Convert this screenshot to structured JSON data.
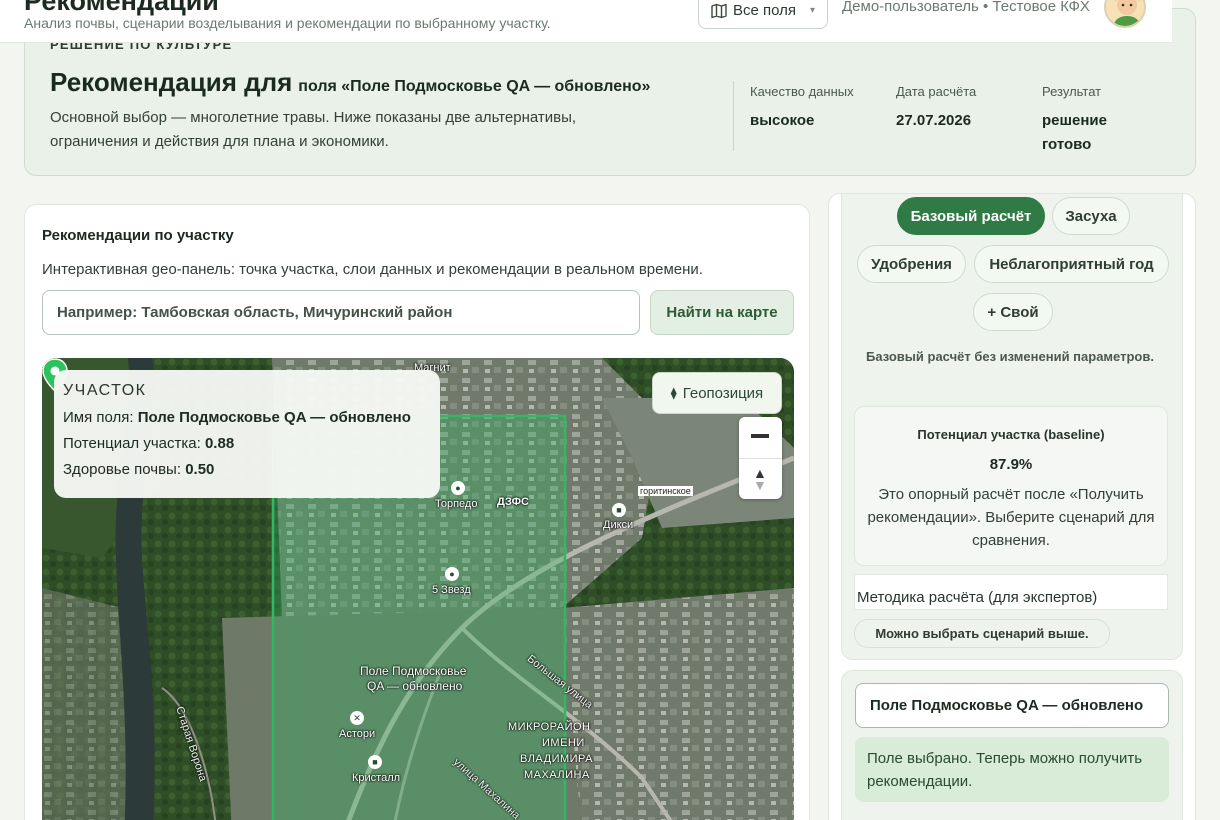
{
  "header": {
    "title": "Рекомендации",
    "subtitle": "Анализ почвы, сценарии возделывания и рекомендации по выбранному участку.",
    "fields_select": "Все поля",
    "user": "Демо-пользователь • Тестовое КФХ"
  },
  "decision": {
    "kicker": "РЕШЕНИЕ ПО КУЛЬТУРЕ",
    "title_main": "Рекомендация для",
    "title_field": "поля «Поле Подмосковье QA — обновлено»",
    "description": "Основной выбор — многолетние травы. Ниже показаны две альтернативы, ограничения и действия для плана и экономики.",
    "metrics": [
      {
        "label": "Качество данных",
        "value": "высокое"
      },
      {
        "label": "Дата расчёта",
        "value": "27.07.2026"
      },
      {
        "label": "Результат",
        "value": "решение готово"
      }
    ]
  },
  "left_panel": {
    "title": "Рекомендации по участку",
    "description": "Интерактивная geo-панель: точка участка, слои данных и рекомендации в реальном времени.",
    "search_placeholder": "Например: Тамбовская область, Мичуринский район",
    "find_button": "Найти на карте",
    "map": {
      "info": {
        "title": "УЧАСТОК",
        "field_name_label": "Имя поля:",
        "field_name_value": "Поле Подмосковье QA — обновлено",
        "potential_label": "Потенциал участка:",
        "potential_value": "0.88",
        "health_label": "Здоровье почвы:",
        "health_value": "0.50"
      },
      "geo_button": "Геопозиция",
      "labels": {
        "magnit": "Магнит",
        "torpedo": "Торпедо",
        "dzfs": "ДЗФС",
        "diksi": "Дикси",
        "zvezd": "5 Звезд",
        "field_pin_1": "Поле Подмосковье",
        "field_pin_2": "QA — обновлено",
        "bolshaya": "Большая улица",
        "mkr_1": "МИКРОРАЙОН",
        "mkr_2": "ИМЕНИ",
        "mkr_3": "ВЛАДИМИРА",
        "mkr_4": "МАХАЛИНА",
        "astori": "Астори",
        "kristall": "Кристалл",
        "mahalina": "улица Махалина",
        "staraya": "Старая Ворона",
        "road_sign": "горитинское"
      }
    }
  },
  "right_panel": {
    "scenarios": [
      "Базовый расчёт",
      "Засуха",
      "Удобрения",
      "Неблагоприятный год",
      "+ Свой"
    ],
    "scenario_description": "Базовый расчёт без изменений параметров.",
    "baseline": {
      "title": "Потенциал участка (baseline)",
      "value": "87.9%",
      "text": "Это опорный расчёт после «Получить рекомендации». Выберите сценарий для сравнения."
    },
    "method": "Методика расчёта (для экспертов)",
    "method_note": "Можно выбрать сценарий выше.",
    "field_value": "Поле Подмосковье QA — обновлено",
    "field_status": "Поле выбрано. Теперь можно получить рекомендации."
  },
  "colors": {
    "accent": "#2f7a45",
    "field_polygon": "#33b765",
    "card_bg": "#eaf1e9"
  }
}
